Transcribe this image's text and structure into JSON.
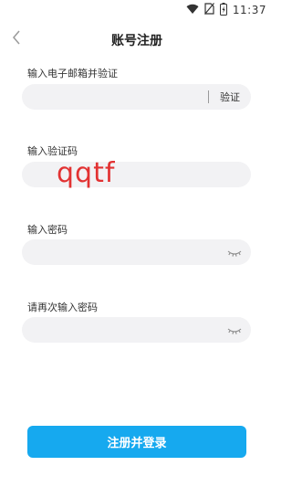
{
  "status_bar": {
    "time": "11:37",
    "icons": [
      "wifi-icon",
      "no-sim-icon",
      "battery-icon"
    ]
  },
  "header": {
    "title": "账号注册",
    "back_icon": "chevron-left-icon"
  },
  "form": {
    "email": {
      "label": "输入电子邮箱并验证",
      "value": "",
      "action_label": "验证"
    },
    "code": {
      "label": "输入验证码",
      "value": "",
      "captcha_text": "qqtf"
    },
    "password": {
      "label": "输入密码",
      "value": "",
      "toggle_icon": "eye-closed-icon"
    },
    "confirm_password": {
      "label": "请再次输入密码",
      "value": "",
      "toggle_icon": "eye-closed-icon"
    }
  },
  "submit_label": "注册并登录",
  "colors": {
    "accent": "#16a9ef",
    "captcha": "#e23232",
    "field_bg": "#f2f2f4"
  }
}
